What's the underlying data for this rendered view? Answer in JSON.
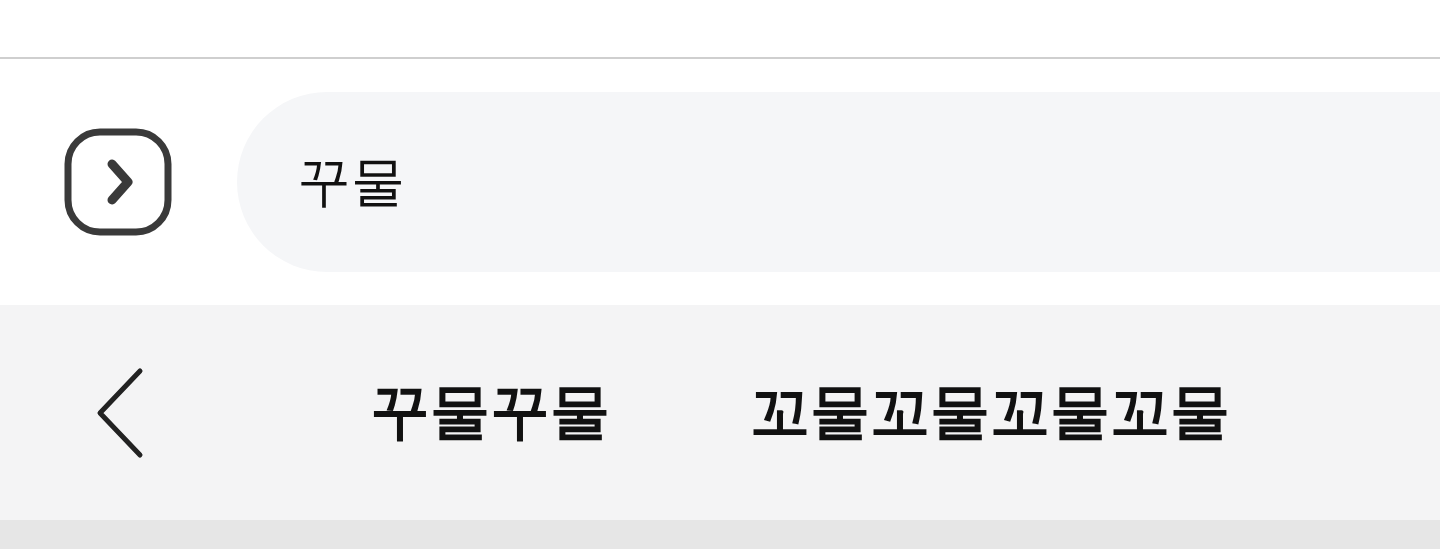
{
  "input": {
    "value": "꾸물"
  },
  "suggestions": [
    "꾸물꾸물",
    "꼬물꼬물꼬물꼬물"
  ]
}
